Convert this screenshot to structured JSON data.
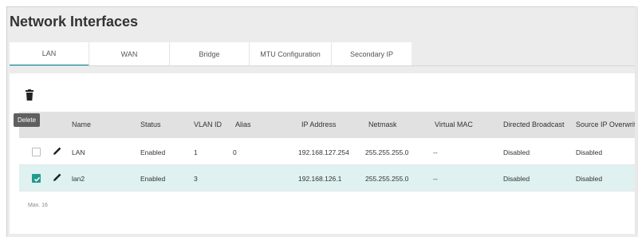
{
  "page": {
    "title": "Network Interfaces"
  },
  "tabs": [
    {
      "label": "LAN",
      "active": true
    },
    {
      "label": "WAN",
      "active": false
    },
    {
      "label": "Bridge",
      "active": false
    },
    {
      "label": "MTU Configuration",
      "active": false
    },
    {
      "label": "Secondary IP",
      "active": false
    }
  ],
  "toolbar": {
    "delete_icon": "trash-icon",
    "tooltip": "Delete"
  },
  "table": {
    "columns": [
      "Name",
      "Status",
      "VLAN ID",
      "Alias",
      "IP Address",
      "Netmask",
      "Virtual MAC",
      "Directed Broadcast",
      "Source IP Overwrite"
    ],
    "rows": [
      {
        "checked": false,
        "name": "LAN",
        "status": "Enabled",
        "vlan_id": "1",
        "alias": "0",
        "ip": "192.168.127.254",
        "netmask": "255.255.255.0",
        "virtual_mac": "--",
        "directed_broadcast": "Disabled",
        "source_ip_overwrite": "Disabled"
      },
      {
        "checked": true,
        "name": "lan2",
        "status": "Enabled",
        "vlan_id": "3",
        "alias": "",
        "ip": "192.168.126.1",
        "netmask": "255.255.255.0",
        "virtual_mac": "--",
        "directed_broadcast": "Disabled",
        "source_ip_overwrite": "Disabled"
      }
    ],
    "footer": "Max. 16"
  },
  "colors": {
    "accent": "#00838f",
    "checkbox_on": "#239a8b",
    "selected_row": "#dff1f1",
    "header_bg": "#e1e1e1"
  }
}
